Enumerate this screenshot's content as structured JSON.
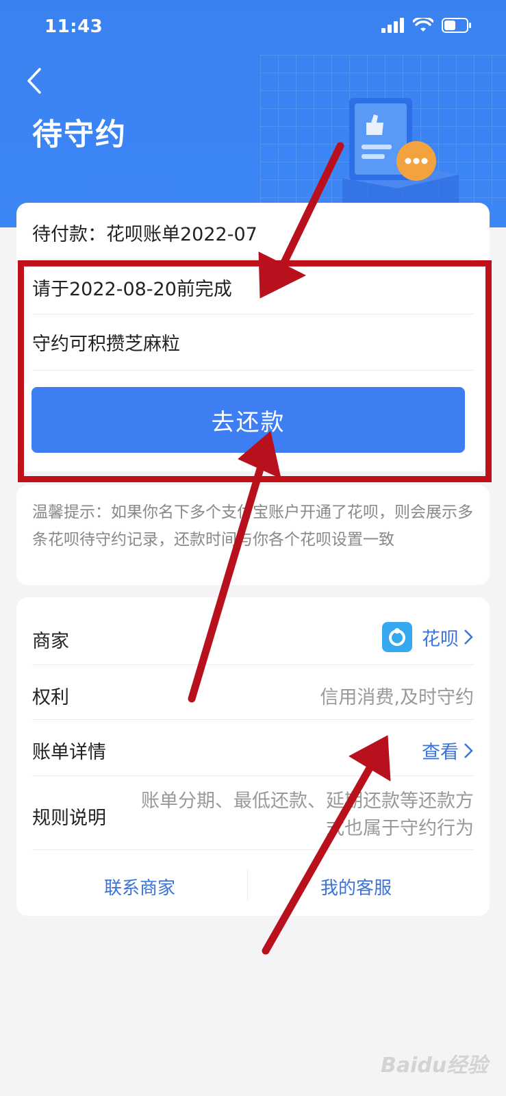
{
  "status_bar": {
    "time": "11:43"
  },
  "header": {
    "title": "待守约"
  },
  "main_card": {
    "pending_payment": "待付款：花呗账单2022-07",
    "deadline": "请于2022-08-20前完成",
    "reward": "守约可积攒芝麻粒",
    "pay_button_label": "去还款"
  },
  "tip": {
    "text": "温馨提示：如果你名下多个支付宝账户开通了花呗，则会展示多条花呗待守约记录，还款时间与你各个花呗设置一致"
  },
  "info": {
    "merchant_label": "商家",
    "merchant_value": "花呗",
    "rights_label": "权利",
    "rights_value": "信用消费,及时守约",
    "bill_detail_label": "账单详情",
    "bill_detail_value": "查看",
    "rules_label": "规则说明",
    "rules_value": "账单分期、最低还款、延期还款等还款方式也属于守约行为",
    "contact_merchant": "联系商家",
    "my_service": "我的客服"
  },
  "watermark": "Baidu经验",
  "colors": {
    "header_blue": "#3b82f1",
    "button_blue": "#3d7ff2",
    "link_blue": "#3a73d9",
    "annotation_red": "#c0101a"
  }
}
